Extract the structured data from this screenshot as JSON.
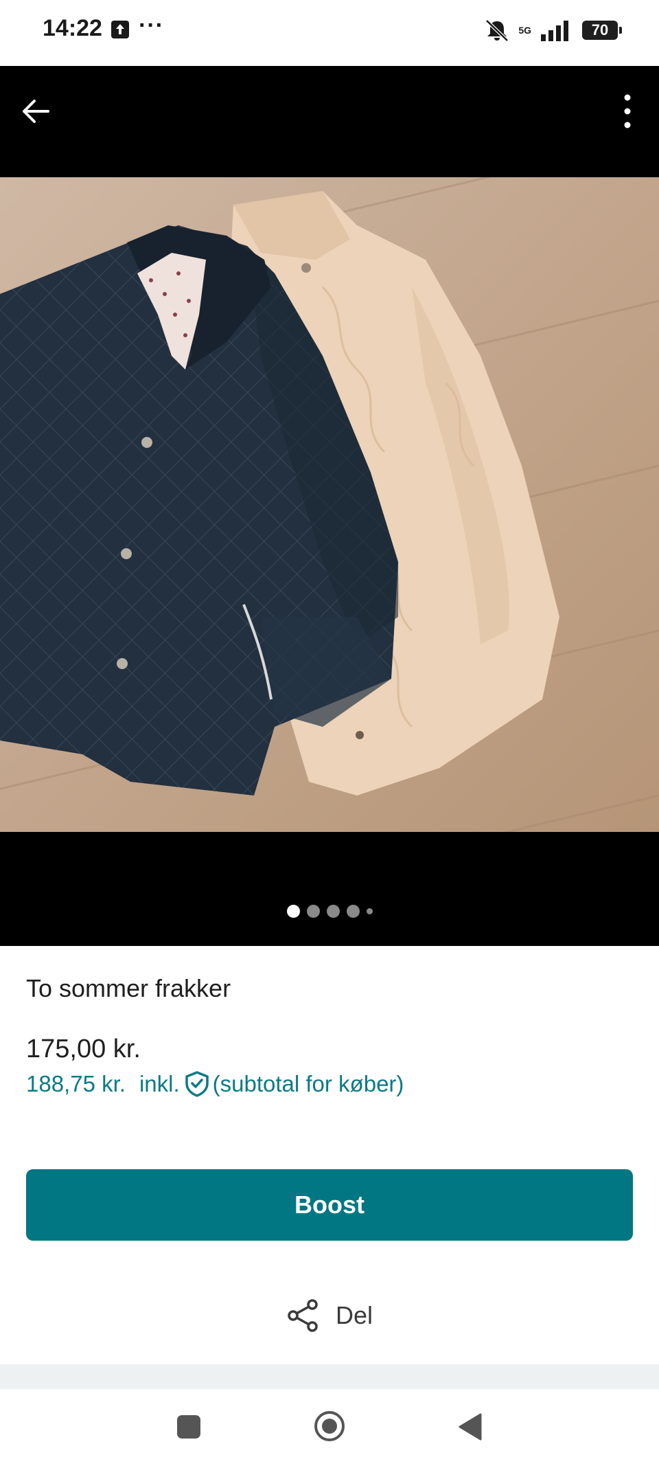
{
  "status_bar": {
    "time": "14:22",
    "icons": [
      "upload-icon",
      "more-dots-icon",
      "mute-icon",
      "signal-icon",
      "battery-icon"
    ],
    "network": "5G",
    "battery": "70"
  },
  "toolbar": {
    "back_icon": "arrow-left-icon",
    "menu_icon": "vertical-dots-icon"
  },
  "gallery": {
    "total_images": 5,
    "active_index": 0
  },
  "listing": {
    "title": "To sommer frakker",
    "price": "175,00 kr.",
    "price_with_fee": "188,75 kr.",
    "fee_label": "inkl.",
    "fee_note": "(subtotal for køber)"
  },
  "actions": {
    "boost_label": "Boost",
    "share_label": "Del"
  },
  "colors": {
    "accent": "#007782",
    "link": "#0b7a86",
    "viewer_bg": "#000000"
  }
}
